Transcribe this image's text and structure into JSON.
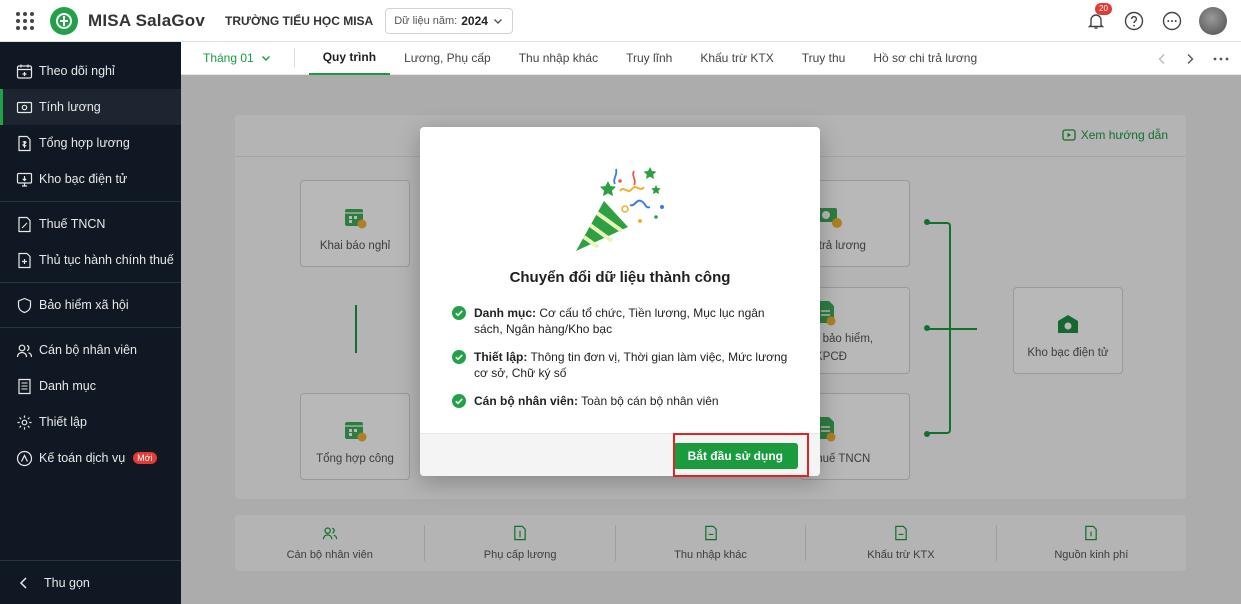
{
  "topbar": {
    "app_name": "MISA SalaGov",
    "org_name": "TRƯỜNG TIỂU HỌC MISA",
    "data_year_label": "Dữ liệu năm:",
    "data_year_value": "2024",
    "notification_count": "20"
  },
  "sidebar": {
    "items": [
      {
        "label": "Theo dõi nghỉ",
        "icon": "calendar-icon"
      },
      {
        "label": "Tính lương",
        "icon": "payroll-icon"
      },
      {
        "label": "Tổng hợp lương",
        "icon": "salary-summary-icon"
      },
      {
        "label": "Kho bạc điện tử",
        "icon": "monitor-icon"
      },
      {
        "label": "Thuế TNCN",
        "icon": "tax-icon"
      },
      {
        "label": "Thủ tục hành chính thuế",
        "icon": "document-icon"
      },
      {
        "label": "Bảo hiểm xã hội",
        "icon": "shield-icon"
      },
      {
        "label": "Cán bộ nhân viên",
        "icon": "users-icon"
      },
      {
        "label": "Danh mục",
        "icon": "list-icon"
      },
      {
        "label": "Thiết lập",
        "icon": "gear-icon"
      },
      {
        "label": "Kế toán dịch vụ",
        "icon": "accounting-icon",
        "badge": "Mới"
      }
    ],
    "collapse_label": "Thu gọn"
  },
  "tabs": {
    "month": "Tháng 01",
    "items": [
      "Quy trình",
      "Lương, Phụ cấp",
      "Thu nhập khác",
      "Truy lĩnh",
      "Khấu trừ KTX",
      "Truy thu",
      "Hồ sơ chi trả lương"
    ],
    "active": "Quy trình"
  },
  "process": {
    "guide_label": "Xem hướng dẫn",
    "steps": {
      "leave": "Khai báo nghỉ",
      "attendance": "Tổng hợp công",
      "payment": "i trả lương",
      "insurance_1": "n bảo hiểm,",
      "insurance_2": "KPCĐ",
      "tax": "thuế TNCN",
      "treasury": "Kho bạc điện tử"
    },
    "bottom": [
      "Cán bộ nhân viên",
      "Phụ cấp lương",
      "Thu nhập khác",
      "Khấu trừ KTX",
      "Nguồn kinh phí"
    ]
  },
  "modal": {
    "title": "Chuyển đổi dữ liệu thành công",
    "items": [
      {
        "label": "Danh mục:",
        "text": " Cơ cấu tổ chức, Tiền lương, Mục lục ngân sách, Ngân hàng/Kho bạc"
      },
      {
        "label": "Thiết lập:",
        "text": " Thông tin đơn vị, Thời gian làm việc, Mức lương cơ sở, Chữ ký số"
      },
      {
        "label": "Cán bộ nhân viên:",
        "text": " Toàn bộ cán bộ nhân viên"
      }
    ],
    "start_button": "Bắt đầu sử dụng"
  },
  "colors": {
    "brand_green": "#1a9c3e",
    "sidebar_bg": "#101923",
    "highlight_red": "#e02424"
  }
}
